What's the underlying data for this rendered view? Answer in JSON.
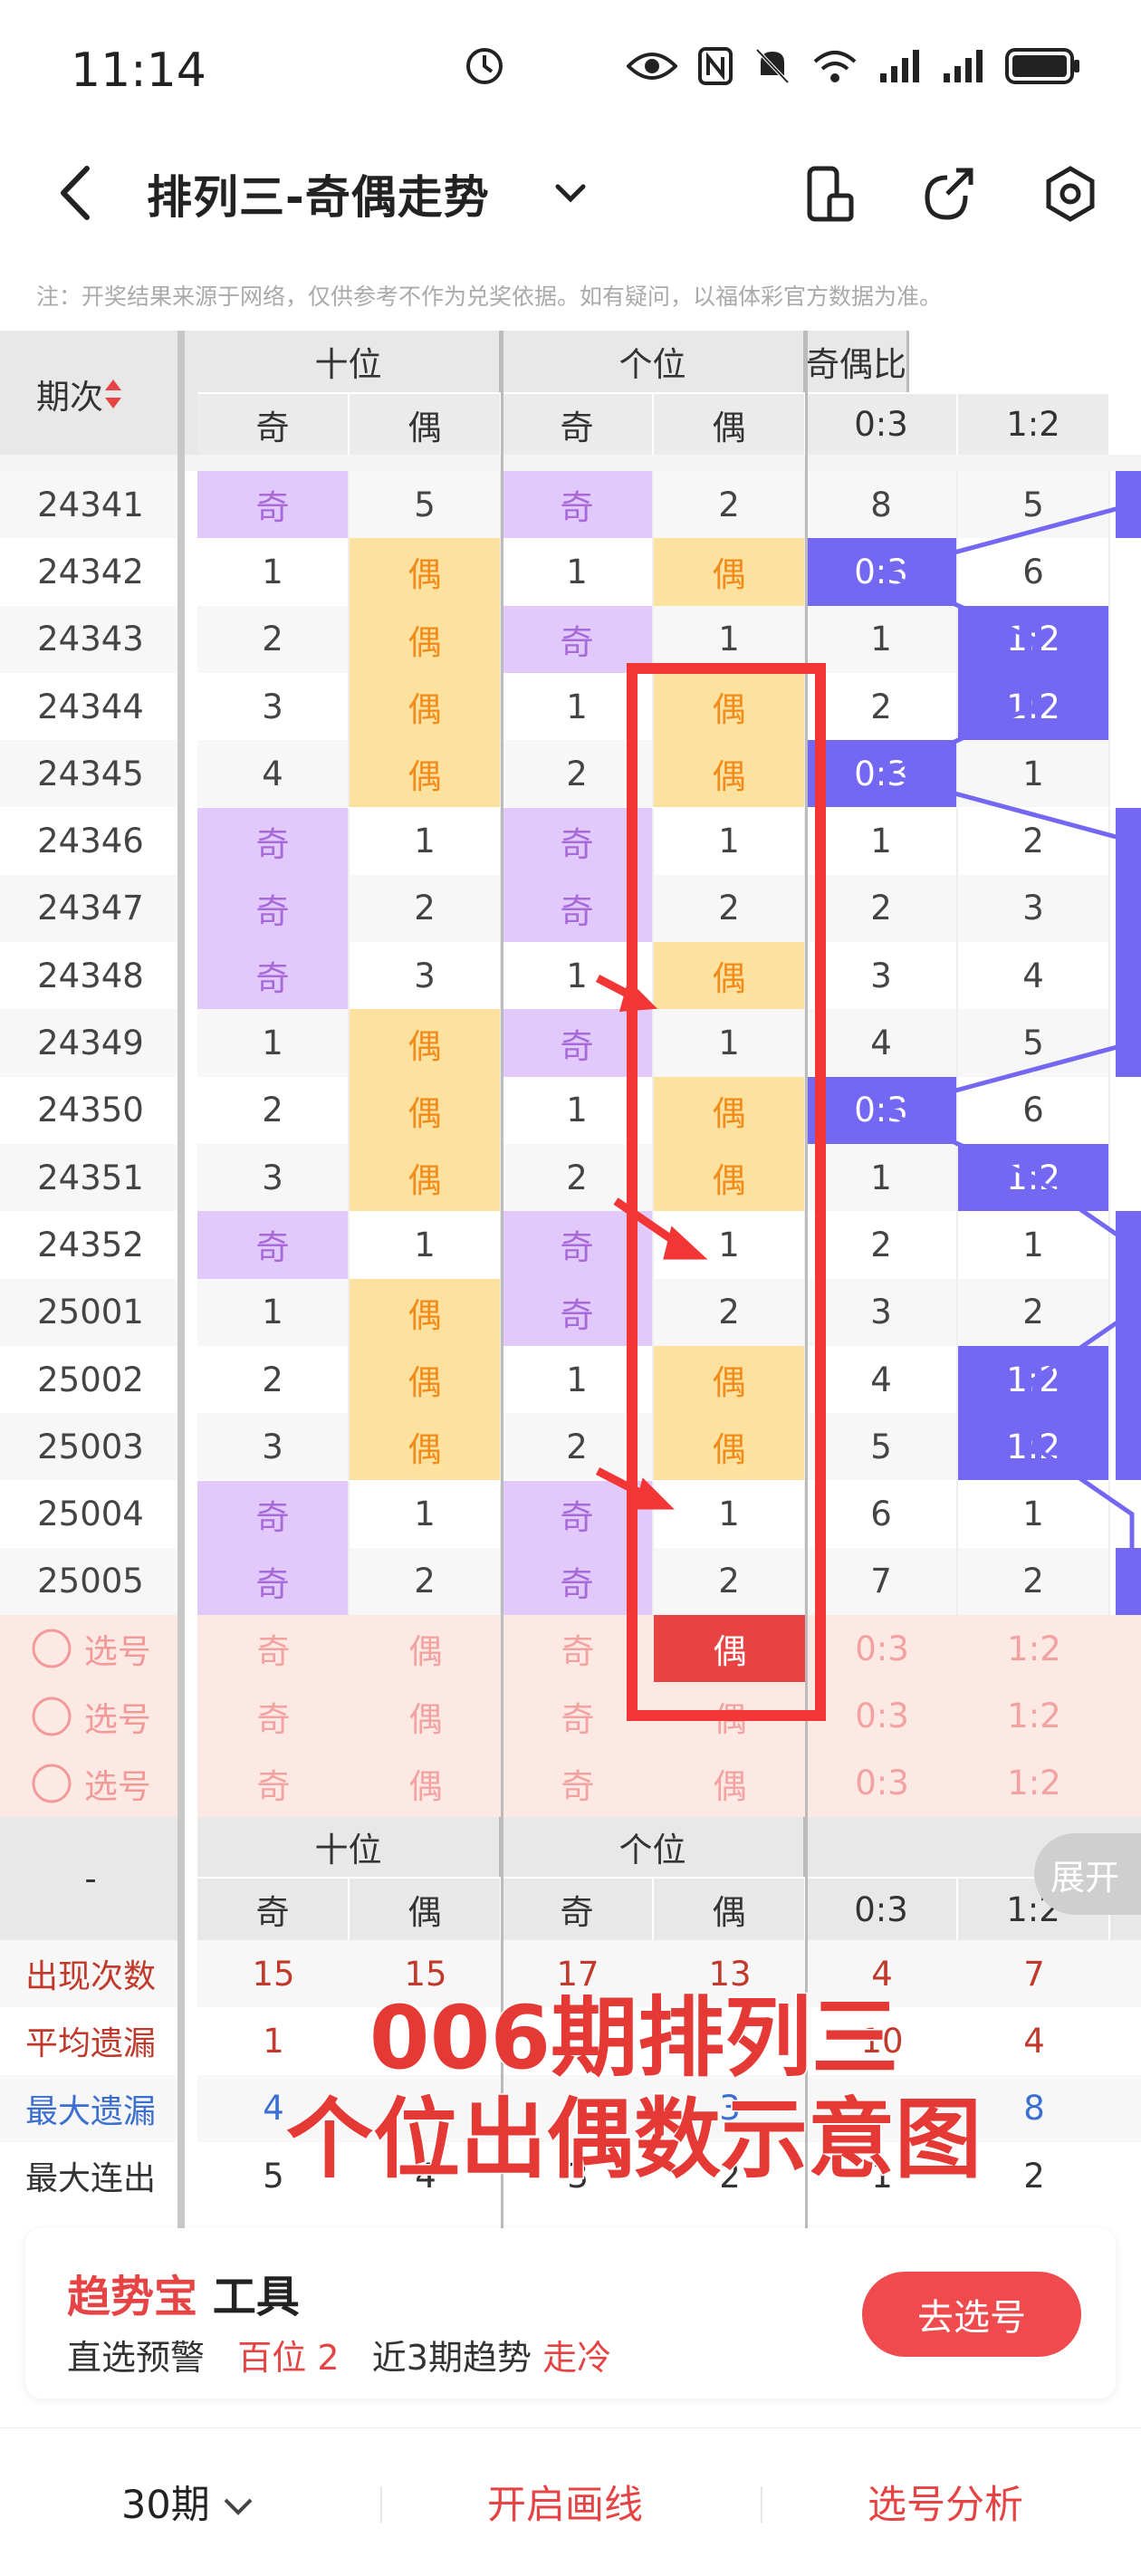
{
  "status": {
    "time": "11:14"
  },
  "header": {
    "title": "排列三-奇偶走势"
  },
  "notice": "注：开奖结果来源于网络，仅供参考不作为兑奖依据。如有疑问，以福体彩官方数据为准。",
  "table": {
    "period_label": "期次",
    "groups": [
      "十位",
      "个位",
      "奇偶比"
    ],
    "subheaders": [
      "奇",
      "偶",
      "奇",
      "偶",
      "0:3",
      "1:2"
    ],
    "rows": [
      {
        "p": "24341",
        "c": [
          "奇",
          "5",
          "奇",
          "2",
          "8",
          "5"
        ]
      },
      {
        "p": "24342",
        "c": [
          "1",
          "偶",
          "1",
          "偶",
          "0:3",
          "6"
        ]
      },
      {
        "p": "24343",
        "c": [
          "2",
          "偶",
          "奇",
          "1",
          "1",
          "1:2"
        ]
      },
      {
        "p": "24344",
        "c": [
          "3",
          "偶",
          "1",
          "偶",
          "2",
          "1:2"
        ]
      },
      {
        "p": "24345",
        "c": [
          "4",
          "偶",
          "2",
          "偶",
          "0:3",
          "1"
        ]
      },
      {
        "p": "24346",
        "c": [
          "奇",
          "1",
          "奇",
          "1",
          "1",
          "2"
        ]
      },
      {
        "p": "24347",
        "c": [
          "奇",
          "2",
          "奇",
          "2",
          "2",
          "3"
        ]
      },
      {
        "p": "24348",
        "c": [
          "奇",
          "3",
          "1",
          "偶",
          "3",
          "4"
        ]
      },
      {
        "p": "24349",
        "c": [
          "1",
          "偶",
          "奇",
          "1",
          "4",
          "5"
        ]
      },
      {
        "p": "24350",
        "c": [
          "2",
          "偶",
          "1",
          "偶",
          "0:3",
          "6"
        ]
      },
      {
        "p": "24351",
        "c": [
          "3",
          "偶",
          "2",
          "偶",
          "1",
          "1:2"
        ]
      },
      {
        "p": "24352",
        "c": [
          "奇",
          "1",
          "奇",
          "1",
          "2",
          "1"
        ]
      },
      {
        "p": "25001",
        "c": [
          "1",
          "偶",
          "奇",
          "2",
          "3",
          "2"
        ]
      },
      {
        "p": "25002",
        "c": [
          "2",
          "偶",
          "1",
          "偶",
          "4",
          "1:2"
        ]
      },
      {
        "p": "25003",
        "c": [
          "3",
          "偶",
          "2",
          "偶",
          "5",
          "1:2"
        ]
      },
      {
        "p": "25004",
        "c": [
          "奇",
          "1",
          "奇",
          "1",
          "6",
          "1"
        ]
      },
      {
        "p": "25005",
        "c": [
          "奇",
          "2",
          "奇",
          "2",
          "7",
          "2"
        ]
      }
    ],
    "select_label": "选号",
    "select_cells": [
      "奇",
      "偶",
      "奇",
      "偶",
      "0:3",
      "1:2"
    ],
    "stats_dash": "-",
    "stats": [
      {
        "label": "出现次数",
        "v": [
          "15",
          "15",
          "17",
          "13",
          "4",
          "7"
        ]
      },
      {
        "label": "平均遗漏",
        "v": [
          "1",
          "",
          "",
          "",
          "10",
          "4"
        ]
      },
      {
        "label": "最大遗漏",
        "v": [
          "4",
          "",
          "",
          "3",
          "",
          "8"
        ]
      },
      {
        "label": "最大连出",
        "v": [
          "5",
          "4",
          "3",
          "2",
          "1",
          "2"
        ]
      }
    ],
    "expand_label": "展开"
  },
  "caption": {
    "line1": "006期排列三",
    "line2": "个位出偶数示意图"
  },
  "card": {
    "brand": "趋势宝",
    "tool": " 工具",
    "line_a": "直选预警",
    "line_b": "百位 2",
    "line_c": "近3期趋势",
    "line_d": "走冷",
    "button": "去选号"
  },
  "bottom": {
    "periods": "30期",
    "draw": "开启画线",
    "analysis": "选号分析"
  },
  "colors": {
    "odd_bg": "#e2c9fb",
    "even_bg": "#fde29f",
    "ratio_bg": "#7468f2",
    "accent": "#e64444",
    "select_bg": "#fde9e3"
  }
}
